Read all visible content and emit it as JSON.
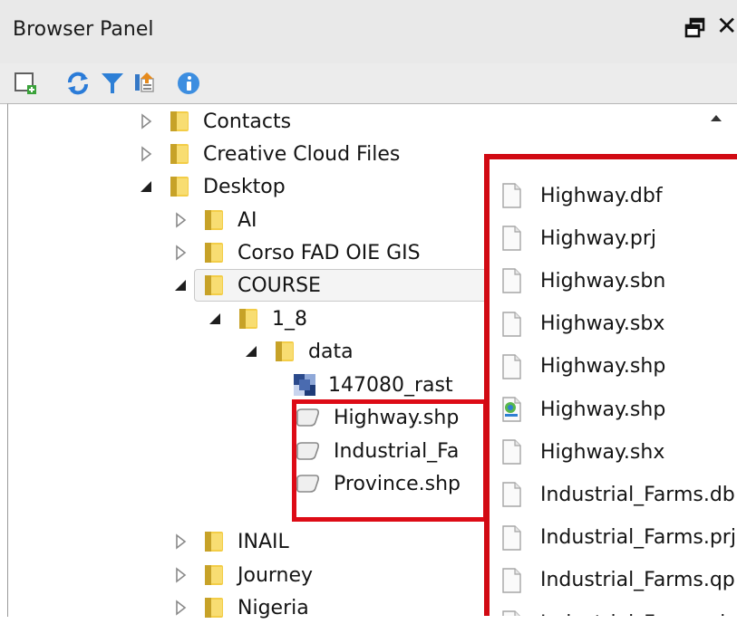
{
  "panel": {
    "title": "Browser Panel",
    "close_label": "✕",
    "toolbar": [
      {
        "name": "add-layer-icon"
      },
      {
        "name": "refresh-icon"
      },
      {
        "name": "filter-icon"
      },
      {
        "name": "collapse-all-icon"
      },
      {
        "name": "info-icon"
      }
    ]
  },
  "tree": {
    "items": [
      {
        "label": "Contacts",
        "state": "collapsed",
        "icon": "folder-icon"
      },
      {
        "label": "Creative Cloud Files",
        "state": "collapsed",
        "icon": "folder-icon"
      },
      {
        "label": "Desktop",
        "state": "expanded",
        "icon": "folder-icon"
      },
      {
        "label": "AI",
        "state": "collapsed",
        "icon": "folder-icon"
      },
      {
        "label": "Corso FAD OIE GIS",
        "state": "collapsed",
        "icon": "folder-icon"
      },
      {
        "label": "COURSE",
        "state": "expanded",
        "icon": "folder-icon",
        "selected": true
      },
      {
        "label": "1_8",
        "state": "expanded",
        "icon": "folder-icon"
      },
      {
        "label": "data",
        "state": "expanded",
        "icon": "folder-icon"
      },
      {
        "label": "147080_rast",
        "state": "leaf",
        "icon": "raster-icon"
      },
      {
        "label": "Highway.shp",
        "state": "leaf",
        "icon": "polygon-layer-icon"
      },
      {
        "label": "Industrial_Fa",
        "state": "leaf",
        "icon": "polygon-layer-icon"
      },
      {
        "label": "Province.shp",
        "state": "leaf",
        "icon": "polygon-layer-icon"
      },
      {
        "label": "INAIL",
        "state": "collapsed",
        "icon": "folder-icon"
      },
      {
        "label": "Journey",
        "state": "collapsed",
        "icon": "folder-icon"
      },
      {
        "label": "Nigeria",
        "state": "collapsed",
        "icon": "folder-icon"
      }
    ]
  },
  "files": {
    "items": [
      {
        "label": "Highway.dbf",
        "icon": "file-icon"
      },
      {
        "label": "Highway.prj",
        "icon": "file-icon"
      },
      {
        "label": "Highway.sbn",
        "icon": "file-icon"
      },
      {
        "label": "Highway.sbx",
        "icon": "file-icon"
      },
      {
        "label": "Highway.shp",
        "icon": "file-icon"
      },
      {
        "label": "Highway.shp",
        "icon": "qgis-file-icon"
      },
      {
        "label": "Highway.shx",
        "icon": "file-icon"
      },
      {
        "label": "Industrial_Farms.db",
        "icon": "file-icon"
      },
      {
        "label": "Industrial_Farms.prj",
        "icon": "file-icon"
      },
      {
        "label": "Industrial_Farms.qp",
        "icon": "file-icon"
      },
      {
        "label": "Industrial_Farms.sh",
        "icon": "file-icon"
      }
    ]
  },
  "colors": {
    "highlight_red": "#dd0b16",
    "folder_yellow": "#f0c330",
    "selection_bg": "#f4f4f4"
  }
}
